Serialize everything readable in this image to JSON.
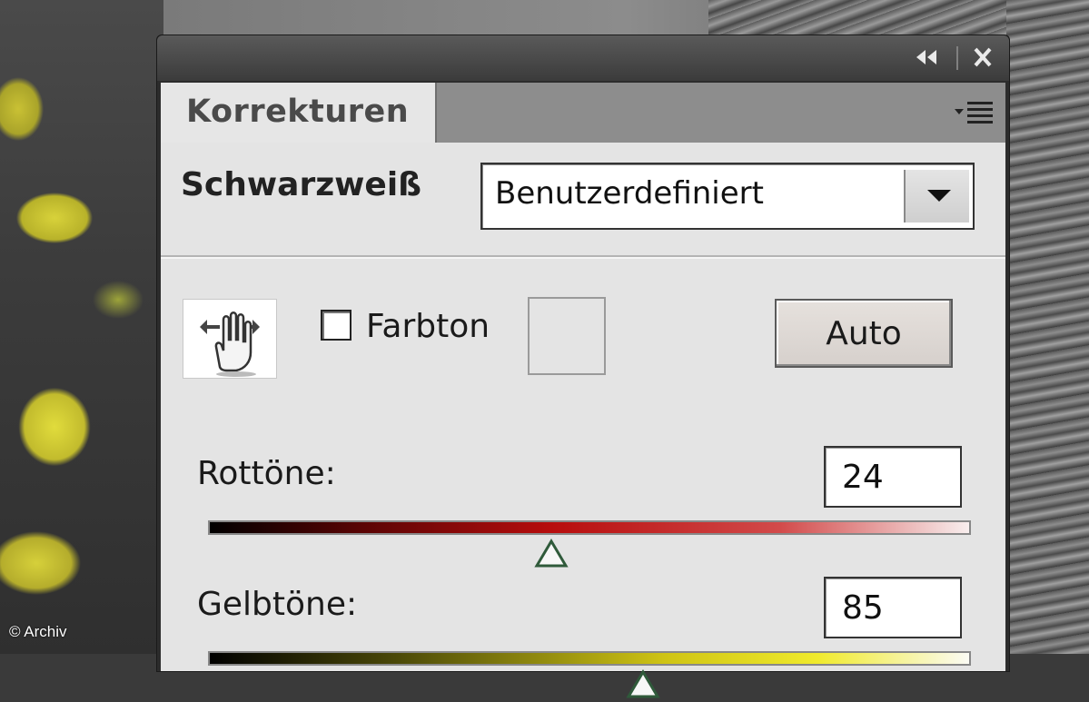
{
  "panel": {
    "tab_label": "Korrekturen",
    "heading": "Schwarzweiß",
    "preset": {
      "value": "Benutzerdefiniert"
    },
    "tint": {
      "label": "Farbton",
      "checked": false
    },
    "auto_label": "Auto",
    "sliders": [
      {
        "label": "Rottöne:",
        "value": "24",
        "fraction": 0.45,
        "color": "red"
      },
      {
        "label": "Gelbtöne:",
        "value": "85",
        "fraction": 0.57,
        "color": "yellow"
      }
    ]
  },
  "titlebar": {
    "collapse_icon": "double-chevron-left-icon",
    "close_icon": "close-icon"
  },
  "copyright": "© Archiv"
}
